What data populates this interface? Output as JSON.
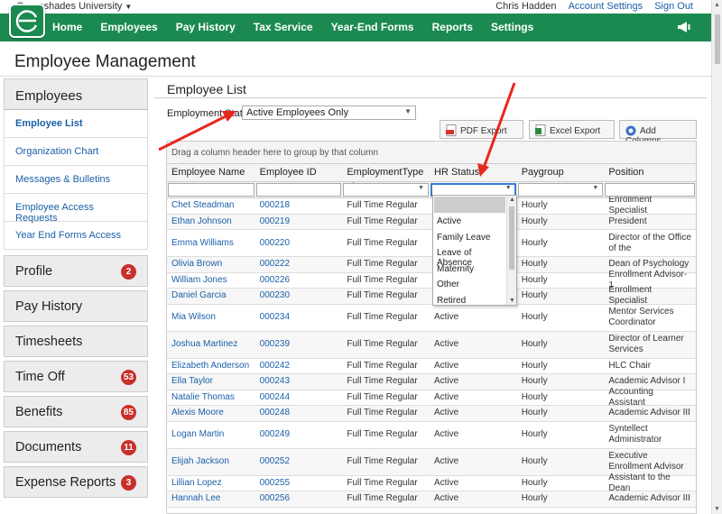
{
  "topbar": {
    "org": "Greenshades University",
    "user": "Chris Hadden",
    "account_settings": "Account Settings",
    "sign_out": "Sign Out"
  },
  "nav": {
    "items": [
      "Home",
      "Employees",
      "Pay History",
      "Tax Service",
      "Year-End Forms",
      "Reports",
      "Settings"
    ],
    "accent": "#1b8a50"
  },
  "page": {
    "title": "Employee Management"
  },
  "sidebar": {
    "head": "Employees",
    "sub": [
      "Employee List",
      "Organization Chart",
      "Messages & Bulletins",
      "Employee Access Requests",
      "Year End Forms Access"
    ],
    "sections": [
      {
        "label": "Profile",
        "badge": "2"
      },
      {
        "label": "Pay History",
        "badge": ""
      },
      {
        "label": "Timesheets",
        "badge": ""
      },
      {
        "label": "Time Off",
        "badge": "53"
      },
      {
        "label": "Benefits",
        "badge": "85"
      },
      {
        "label": "Documents",
        "badge": "11"
      },
      {
        "label": "Expense Reports",
        "badge": "3"
      }
    ]
  },
  "main": {
    "title": "Employee List",
    "status_label": "Employment Status:",
    "status_value": "Active Employees Only",
    "buttons": {
      "pdf": "PDF Export",
      "excel": "Excel Export",
      "add": "Add Columns"
    },
    "group_hint": "Drag a column header here to group by that column",
    "columns": [
      "Employee Name",
      "Employee ID",
      "EmploymentType",
      "HR Status",
      "Paygroup",
      "Position"
    ],
    "hr_status_options": [
      "Active",
      "Family Leave",
      "Leave of Absence",
      "Maternity",
      "Other",
      "Retired"
    ],
    "rows": [
      {
        "name": "Chet Steadman",
        "id": "000218",
        "type": "Full Time Regular",
        "status": "",
        "pay": "Hourly",
        "pos": "Enrollment Specialist"
      },
      {
        "name": "Ethan Johnson",
        "id": "000219",
        "type": "Full Time Regular",
        "status": "",
        "pay": "Hourly",
        "pos": "President"
      },
      {
        "name": "Emma Williams",
        "id": "000220",
        "type": "Full Time Regular",
        "status": "",
        "pay": "Hourly",
        "pos": "Director of the Office of the"
      },
      {
        "name": "Olivia Brown",
        "id": "000222",
        "type": "Full Time Regular",
        "status": "",
        "pay": "Hourly",
        "pos": "Dean of Psychology"
      },
      {
        "name": "William Jones",
        "id": "000226",
        "type": "Full Time Regular",
        "status": "",
        "pay": "Hourly",
        "pos": "Enrollment Advisor-1"
      },
      {
        "name": "Daniel Garcia",
        "id": "000230",
        "type": "Full Time Regular",
        "status": "",
        "pay": "Hourly",
        "pos": "Enrollment Specialist"
      },
      {
        "name": "Mia Wilson",
        "id": "000234",
        "type": "Full Time Regular",
        "status": "Active",
        "pay": "Hourly",
        "pos": "Mentor Services Coordinator"
      },
      {
        "name": "Joshua Martinez",
        "id": "000239",
        "type": "Full Time Regular",
        "status": "Active",
        "pay": "Hourly",
        "pos": "Director of Learner Services"
      },
      {
        "name": "Elizabeth Anderson",
        "id": "000242",
        "type": "Full Time Regular",
        "status": "Active",
        "pay": "Hourly",
        "pos": "HLC Chair"
      },
      {
        "name": "Ella Taylor",
        "id": "000243",
        "type": "Full Time Regular",
        "status": "Active",
        "pay": "Hourly",
        "pos": "Academic Advisor I"
      },
      {
        "name": "Natalie Thomas",
        "id": "000244",
        "type": "Full Time Regular",
        "status": "Active",
        "pay": "Hourly",
        "pos": "Accounting Assistant"
      },
      {
        "name": "Alexis Moore",
        "id": "000248",
        "type": "Full Time Regular",
        "status": "Active",
        "pay": "Hourly",
        "pos": "Academic Advisor III"
      },
      {
        "name": "Logan Martin",
        "id": "000249",
        "type": "Full Time Regular",
        "status": "Active",
        "pay": "Hourly",
        "pos": "Syntellect Administrator"
      },
      {
        "name": "Elijah Jackson",
        "id": "000252",
        "type": "Full Time Regular",
        "status": "Active",
        "pay": "Hourly",
        "pos": "Executive Enrollment Advisor"
      },
      {
        "name": "Lillian Lopez",
        "id": "000255",
        "type": "Full Time Regular",
        "status": "Active",
        "pay": "Hourly",
        "pos": "Assistant to the Dean"
      },
      {
        "name": "Hannah Lee",
        "id": "000256",
        "type": "Full Time Regular",
        "status": "Active",
        "pay": "Hourly",
        "pos": "Academic Advisor III"
      }
    ]
  }
}
